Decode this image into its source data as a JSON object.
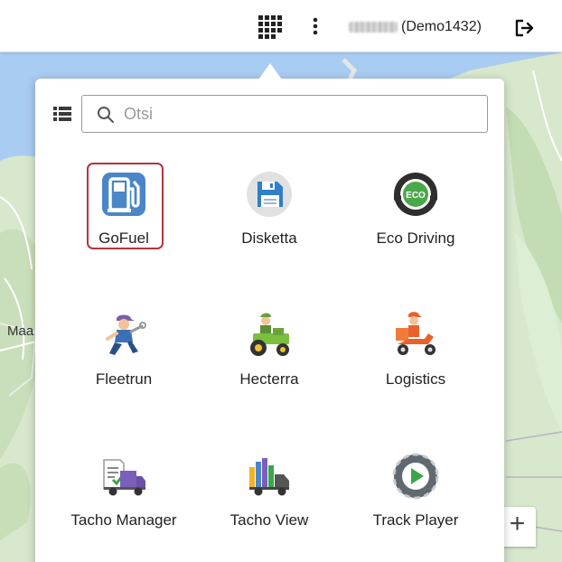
{
  "topbar": {
    "apps_icon": "apps-grid-icon",
    "more_icon": "more-vertical-icon",
    "user_label": "(Demo1432)",
    "logout_icon": "logout-icon"
  },
  "launcher": {
    "list_icon": "list-view-icon",
    "search": {
      "placeholder": "Otsi",
      "value": "",
      "icon": "search-icon"
    },
    "apps": [
      {
        "label": "GoFuel",
        "icon": "fuel-pump-icon",
        "selected": true
      },
      {
        "label": "Disketta",
        "icon": "floppy-disk-icon"
      },
      {
        "label": "Eco Driving",
        "icon": "eco-steering-wheel-icon"
      },
      {
        "label": "Fleetrun",
        "icon": "mechanic-icon"
      },
      {
        "label": "Hecterra",
        "icon": "tractor-icon"
      },
      {
        "label": "Logistics",
        "icon": "scooter-courier-icon"
      },
      {
        "label": "Tacho Manager",
        "icon": "truck-document-icon"
      },
      {
        "label": "Tacho View",
        "icon": "truck-chart-icon"
      },
      {
        "label": "Track Player",
        "icon": "play-track-icon"
      }
    ]
  },
  "map": {
    "visible_label": "Maa",
    "zoom_in_label": "+"
  },
  "colors": {
    "selected_frame": "#b4343b",
    "gofuel_blue": "#4a86c8",
    "water": "#a9ccf2",
    "land": "#d2e6c8"
  }
}
